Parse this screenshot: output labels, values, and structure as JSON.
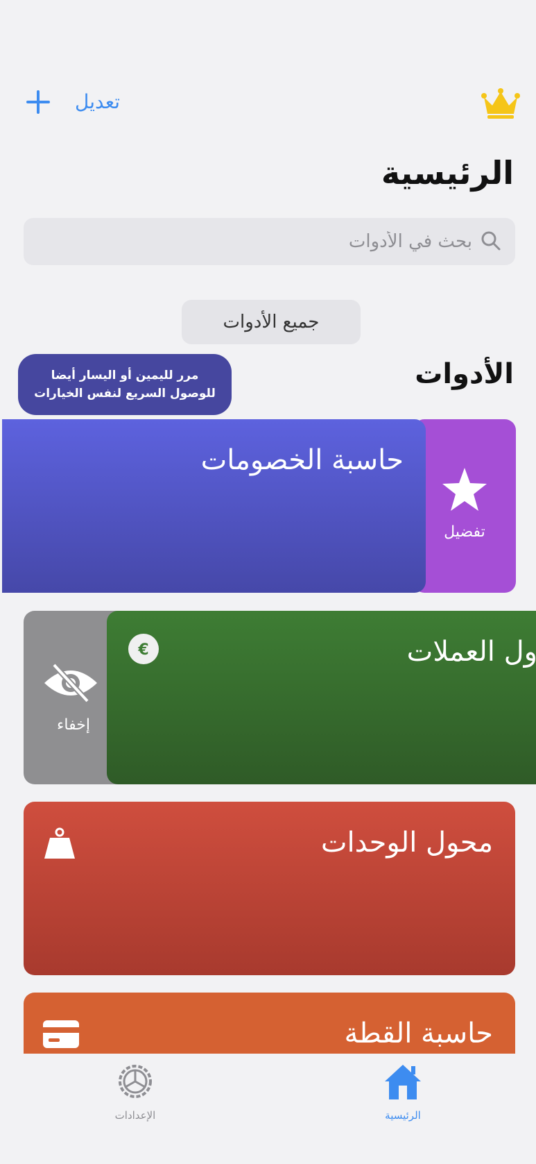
{
  "header": {
    "edit_label": "تعديل",
    "page_title": "الرئيسية"
  },
  "search": {
    "placeholder": "بحث في الأدوات"
  },
  "filter": {
    "selected": "جميع الأدوات"
  },
  "tip": {
    "line1": "مرر لليمين أو اليسار أيضا",
    "line2": "للوصول السريع لنفس الخيارات"
  },
  "section": {
    "title": "الأدوات"
  },
  "tools": [
    {
      "title": "حاسبة الخصومات",
      "color": "#5d62de",
      "swipe_action": "تفضيل",
      "swipe_color": "#a54fd6"
    },
    {
      "title": "ول العملات",
      "color": "#3e7d34",
      "swipe_action": "إخفاء",
      "swipe_color": "#8f8f91",
      "icon": "currency-icon"
    },
    {
      "title": "محول الوحدات",
      "color": "#cf4e3e",
      "icon": "weight-icon"
    },
    {
      "title": "حاسبة القطة",
      "color": "#d56132",
      "icon": "card-icon"
    }
  ],
  "tabbar": {
    "home_label": "الرئيسية",
    "settings_label": "الإعدادات",
    "active_color": "#3d8cf0",
    "inactive_color": "#8e8e93"
  }
}
